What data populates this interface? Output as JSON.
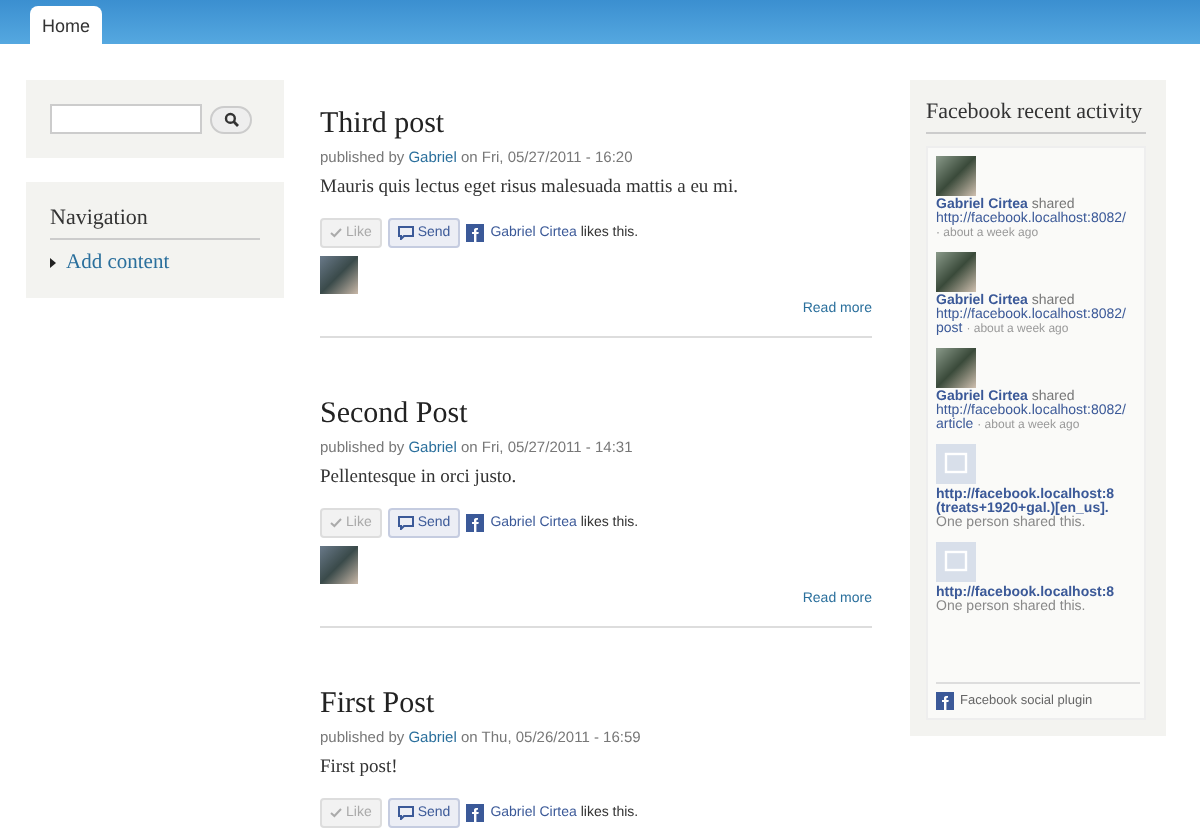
{
  "tabs": [
    {
      "label": "Home",
      "selected": true
    }
  ],
  "navigation": {
    "title": "Navigation",
    "items": [
      "Add content"
    ]
  },
  "posts": [
    {
      "title": "Third post",
      "by": "published by",
      "author": "Gabriel",
      "date": "on Fri, 05/27/2011 - 16:20",
      "body": "Mauris quis lectus eget risus malesuada mattis a eu mi.",
      "like": "Like",
      "send": "Send",
      "liker": "Gabriel Cirtea",
      "likes_text": "likes this.",
      "photo": true,
      "read_more": "Read more"
    },
    {
      "title": "Second Post",
      "by": "published by",
      "author": "Gabriel",
      "date": "on Fri, 05/27/2011 - 14:31",
      "body": "Pellentesque in orci justo.",
      "like": "Like",
      "send": "Send",
      "liker": "Gabriel Cirtea",
      "likes_text": "likes this.",
      "photo": true,
      "read_more": "Read more"
    },
    {
      "title": "First Post",
      "by": "published by",
      "author": "Gabriel",
      "date": "on Thu, 05/26/2011 - 16:59",
      "body": "First post!",
      "like": "Like",
      "send": "Send",
      "liker": "Gabriel Cirtea",
      "likes_text": "likes this."
    }
  ],
  "activity": {
    "title": "Facebook recent activity",
    "items": [
      {
        "kind": "user",
        "name": "Gabriel Cirtea",
        "verb": "shared",
        "url": "http://facebook.localhost:8082/",
        "time": "· about a week ago"
      },
      {
        "kind": "user",
        "name": "Gabriel Cirtea",
        "verb": "shared",
        "url": "http://facebook.localhost:8082/",
        "link_text": "post",
        "time": "· about a week ago"
      },
      {
        "kind": "user",
        "name": "Gabriel Cirtea",
        "verb": "shared",
        "url": "http://facebook.localhost:8082/",
        "link_text": "article",
        "time": "· about a week ago"
      },
      {
        "kind": "link",
        "url_lines": [
          "http://facebook.localhost:8",
          "(treats+1920+gal.)[en_us]."
        ],
        "note": "One person shared this."
      },
      {
        "kind": "link",
        "url_lines": [
          "http://facebook.localhost:8"
        ],
        "note": "One person shared this."
      }
    ],
    "footer": "Facebook social plugin"
  }
}
